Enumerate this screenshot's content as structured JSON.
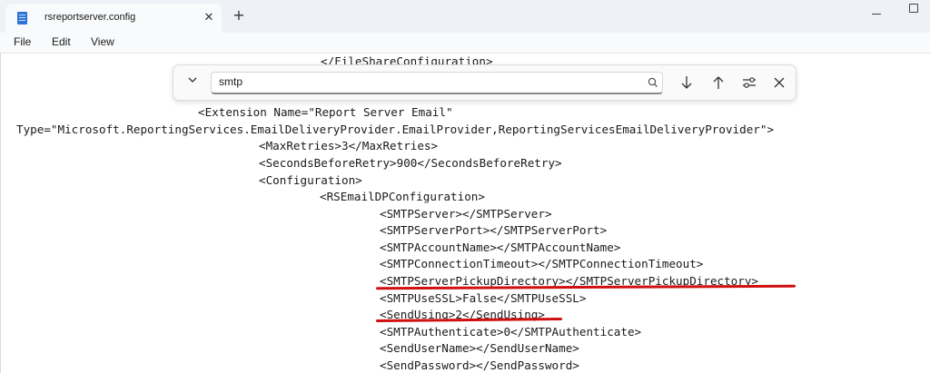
{
  "window": {
    "tab_title": "rsreportserver.config",
    "tab_close": "✕",
    "new_tab": "+"
  },
  "menu": {
    "file": "File",
    "edit": "Edit",
    "view": "View"
  },
  "find": {
    "query": "smtp",
    "toggle_icon": "chevron-down-icon"
  },
  "editor": {
    "lines": [
      "</FileShareConfiguration>",
      "<Extension Name=\"Report Server Email\"",
      "Type=\"Microsoft.ReportingServices.EmailDeliveryProvider.EmailProvider,ReportingServicesEmailDeliveryProvider\">",
      "<MaxRetries>3</MaxRetries>",
      "<SecondsBeforeRetry>900</SecondsBeforeRetry>",
      "<Configuration>",
      "<RSEmailDPConfiguration>",
      "<SMTPServer></SMTPServer>",
      "<SMTPServerPort></SMTPServerPort>",
      "<SMTPAccountName></SMTPAccountName>",
      "<SMTPConnectionTimeout></SMTPConnectionTimeout>",
      "<SMTPServerPickupDirectory></SMTPServerPickupDirectory>",
      "<SMTPUseSSL>False</SMTPUseSSL>",
      "<SendUsing>2</SendUsing>",
      "<SMTPAuthenticate>0</SMTPAuthenticate>",
      "<SendUserName></SendUserName>",
      "<SendPassword></SendPassword>"
    ]
  },
  "colors": {
    "annotation_underline": "#d01010",
    "titlebar": "#eef2f6",
    "file_icon": "#2b74d8"
  }
}
